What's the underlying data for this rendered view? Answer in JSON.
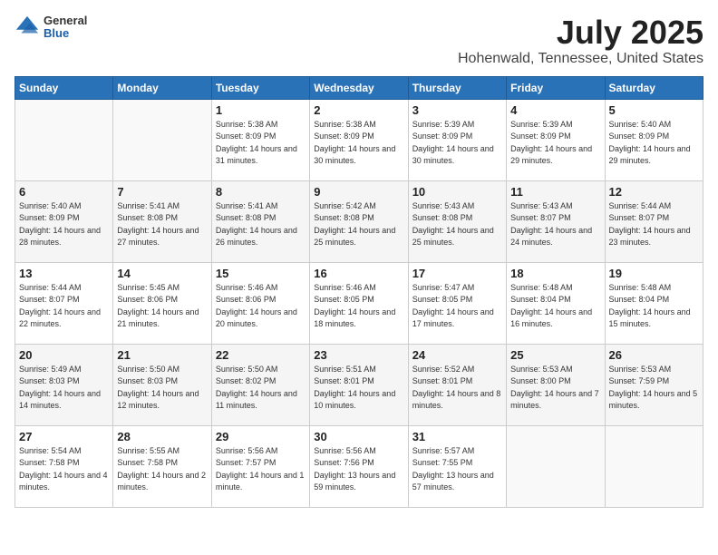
{
  "header": {
    "logo_general": "General",
    "logo_blue": "Blue",
    "month_year": "July 2025",
    "location": "Hohenwald, Tennessee, United States"
  },
  "days_of_week": [
    "Sunday",
    "Monday",
    "Tuesday",
    "Wednesday",
    "Thursday",
    "Friday",
    "Saturday"
  ],
  "weeks": [
    [
      {
        "day": "",
        "sunrise": "",
        "sunset": "",
        "daylight": ""
      },
      {
        "day": "",
        "sunrise": "",
        "sunset": "",
        "daylight": ""
      },
      {
        "day": "1",
        "sunrise": "Sunrise: 5:38 AM",
        "sunset": "Sunset: 8:09 PM",
        "daylight": "Daylight: 14 hours and 31 minutes."
      },
      {
        "day": "2",
        "sunrise": "Sunrise: 5:38 AM",
        "sunset": "Sunset: 8:09 PM",
        "daylight": "Daylight: 14 hours and 30 minutes."
      },
      {
        "day": "3",
        "sunrise": "Sunrise: 5:39 AM",
        "sunset": "Sunset: 8:09 PM",
        "daylight": "Daylight: 14 hours and 30 minutes."
      },
      {
        "day": "4",
        "sunrise": "Sunrise: 5:39 AM",
        "sunset": "Sunset: 8:09 PM",
        "daylight": "Daylight: 14 hours and 29 minutes."
      },
      {
        "day": "5",
        "sunrise": "Sunrise: 5:40 AM",
        "sunset": "Sunset: 8:09 PM",
        "daylight": "Daylight: 14 hours and 29 minutes."
      }
    ],
    [
      {
        "day": "6",
        "sunrise": "Sunrise: 5:40 AM",
        "sunset": "Sunset: 8:09 PM",
        "daylight": "Daylight: 14 hours and 28 minutes."
      },
      {
        "day": "7",
        "sunrise": "Sunrise: 5:41 AM",
        "sunset": "Sunset: 8:08 PM",
        "daylight": "Daylight: 14 hours and 27 minutes."
      },
      {
        "day": "8",
        "sunrise": "Sunrise: 5:41 AM",
        "sunset": "Sunset: 8:08 PM",
        "daylight": "Daylight: 14 hours and 26 minutes."
      },
      {
        "day": "9",
        "sunrise": "Sunrise: 5:42 AM",
        "sunset": "Sunset: 8:08 PM",
        "daylight": "Daylight: 14 hours and 25 minutes."
      },
      {
        "day": "10",
        "sunrise": "Sunrise: 5:43 AM",
        "sunset": "Sunset: 8:08 PM",
        "daylight": "Daylight: 14 hours and 25 minutes."
      },
      {
        "day": "11",
        "sunrise": "Sunrise: 5:43 AM",
        "sunset": "Sunset: 8:07 PM",
        "daylight": "Daylight: 14 hours and 24 minutes."
      },
      {
        "day": "12",
        "sunrise": "Sunrise: 5:44 AM",
        "sunset": "Sunset: 8:07 PM",
        "daylight": "Daylight: 14 hours and 23 minutes."
      }
    ],
    [
      {
        "day": "13",
        "sunrise": "Sunrise: 5:44 AM",
        "sunset": "Sunset: 8:07 PM",
        "daylight": "Daylight: 14 hours and 22 minutes."
      },
      {
        "day": "14",
        "sunrise": "Sunrise: 5:45 AM",
        "sunset": "Sunset: 8:06 PM",
        "daylight": "Daylight: 14 hours and 21 minutes."
      },
      {
        "day": "15",
        "sunrise": "Sunrise: 5:46 AM",
        "sunset": "Sunset: 8:06 PM",
        "daylight": "Daylight: 14 hours and 20 minutes."
      },
      {
        "day": "16",
        "sunrise": "Sunrise: 5:46 AM",
        "sunset": "Sunset: 8:05 PM",
        "daylight": "Daylight: 14 hours and 18 minutes."
      },
      {
        "day": "17",
        "sunrise": "Sunrise: 5:47 AM",
        "sunset": "Sunset: 8:05 PM",
        "daylight": "Daylight: 14 hours and 17 minutes."
      },
      {
        "day": "18",
        "sunrise": "Sunrise: 5:48 AM",
        "sunset": "Sunset: 8:04 PM",
        "daylight": "Daylight: 14 hours and 16 minutes."
      },
      {
        "day": "19",
        "sunrise": "Sunrise: 5:48 AM",
        "sunset": "Sunset: 8:04 PM",
        "daylight": "Daylight: 14 hours and 15 minutes."
      }
    ],
    [
      {
        "day": "20",
        "sunrise": "Sunrise: 5:49 AM",
        "sunset": "Sunset: 8:03 PM",
        "daylight": "Daylight: 14 hours and 14 minutes."
      },
      {
        "day": "21",
        "sunrise": "Sunrise: 5:50 AM",
        "sunset": "Sunset: 8:03 PM",
        "daylight": "Daylight: 14 hours and 12 minutes."
      },
      {
        "day": "22",
        "sunrise": "Sunrise: 5:50 AM",
        "sunset": "Sunset: 8:02 PM",
        "daylight": "Daylight: 14 hours and 11 minutes."
      },
      {
        "day": "23",
        "sunrise": "Sunrise: 5:51 AM",
        "sunset": "Sunset: 8:01 PM",
        "daylight": "Daylight: 14 hours and 10 minutes."
      },
      {
        "day": "24",
        "sunrise": "Sunrise: 5:52 AM",
        "sunset": "Sunset: 8:01 PM",
        "daylight": "Daylight: 14 hours and 8 minutes."
      },
      {
        "day": "25",
        "sunrise": "Sunrise: 5:53 AM",
        "sunset": "Sunset: 8:00 PM",
        "daylight": "Daylight: 14 hours and 7 minutes."
      },
      {
        "day": "26",
        "sunrise": "Sunrise: 5:53 AM",
        "sunset": "Sunset: 7:59 PM",
        "daylight": "Daylight: 14 hours and 5 minutes."
      }
    ],
    [
      {
        "day": "27",
        "sunrise": "Sunrise: 5:54 AM",
        "sunset": "Sunset: 7:58 PM",
        "daylight": "Daylight: 14 hours and 4 minutes."
      },
      {
        "day": "28",
        "sunrise": "Sunrise: 5:55 AM",
        "sunset": "Sunset: 7:58 PM",
        "daylight": "Daylight: 14 hours and 2 minutes."
      },
      {
        "day": "29",
        "sunrise": "Sunrise: 5:56 AM",
        "sunset": "Sunset: 7:57 PM",
        "daylight": "Daylight: 14 hours and 1 minute."
      },
      {
        "day": "30",
        "sunrise": "Sunrise: 5:56 AM",
        "sunset": "Sunset: 7:56 PM",
        "daylight": "Daylight: 13 hours and 59 minutes."
      },
      {
        "day": "31",
        "sunrise": "Sunrise: 5:57 AM",
        "sunset": "Sunset: 7:55 PM",
        "daylight": "Daylight: 13 hours and 57 minutes."
      },
      {
        "day": "",
        "sunrise": "",
        "sunset": "",
        "daylight": ""
      },
      {
        "day": "",
        "sunrise": "",
        "sunset": "",
        "daylight": ""
      }
    ]
  ]
}
